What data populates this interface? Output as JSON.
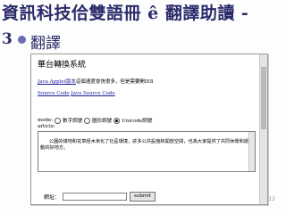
{
  "slide": {
    "title": "資訊科技佮雙語冊 ê 翻譯助讀 -",
    "number_prefix": "3",
    "bullet_text": "翻譯",
    "page_number": "12",
    "colors": {
      "title": "#2b2b6b",
      "bullet": "#6b6bb5"
    }
  },
  "screenshot": {
    "heading": "華台轉換系統",
    "java_line": {
      "link": "Java Applet版本",
      "rest": "這個速度會快很多，但是需要開IE8"
    },
    "code_line": {
      "link1": "Source Code",
      "link2": "Java Source Code"
    },
    "mode": {
      "label": "mode:",
      "options": [
        {
          "label": "數字調號",
          "selected": false
        },
        {
          "label": "圖形調號",
          "selected": false
        },
        {
          "label": "Unicode調號",
          "selected": true
        }
      ]
    },
    "article_label": "article:",
    "article_text": "公園的綠地和花草經木漸化了社區環境，許多公共設施和開放空間，也為大家提供了共同休閒和運動的好地方。",
    "url_label": "網址：",
    "url_value": "",
    "submit_label": "submit"
  }
}
